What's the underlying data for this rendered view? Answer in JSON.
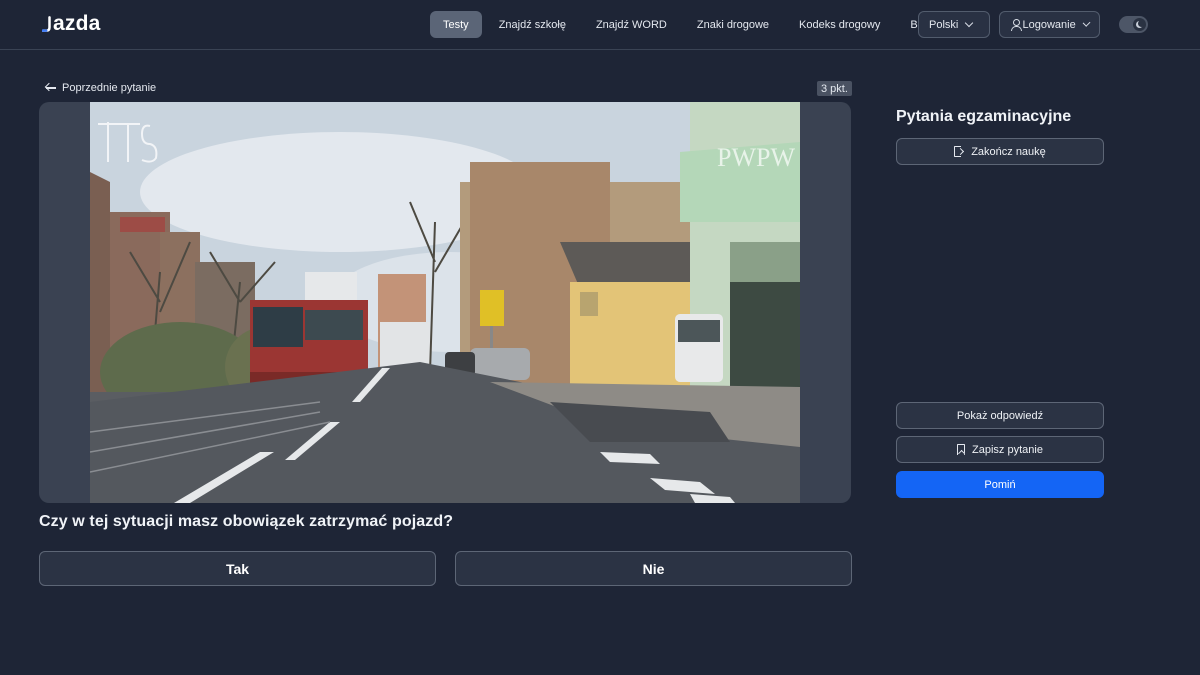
{
  "header": {
    "logo_text": "azda",
    "nav": [
      {
        "label": "Testy",
        "active": true
      },
      {
        "label": "Znajdź szkołę",
        "active": false
      },
      {
        "label": "Znajdź WORD",
        "active": false
      },
      {
        "label": "Znaki drogowe",
        "active": false
      },
      {
        "label": "Kodeks drogowy",
        "active": false
      },
      {
        "label": "Blog",
        "active": false
      }
    ],
    "language": "Polski",
    "login": "Logowanie",
    "theme_toggle_icon": "moon-icon"
  },
  "main": {
    "back_label": "Poprzednie pytanie",
    "points": "3 pkt.",
    "image": {
      "watermark_left": "ITS",
      "watermark_right": "PWPW"
    },
    "question": "Czy w tej sytuacji masz obowiązek zatrzymać pojazd?",
    "answers": [
      "Tak",
      "Nie"
    ]
  },
  "sidebar": {
    "title": "Pytania egzaminacyjne",
    "end_label": "Zakończ naukę",
    "show_answer_label": "Pokaż odpowiedź",
    "save_label": "Zapisz pytanie",
    "skip_label": "Pomiń"
  },
  "colors": {
    "background": "#1e2536",
    "accent": "#1465f5",
    "button_border": "#5d6676"
  }
}
